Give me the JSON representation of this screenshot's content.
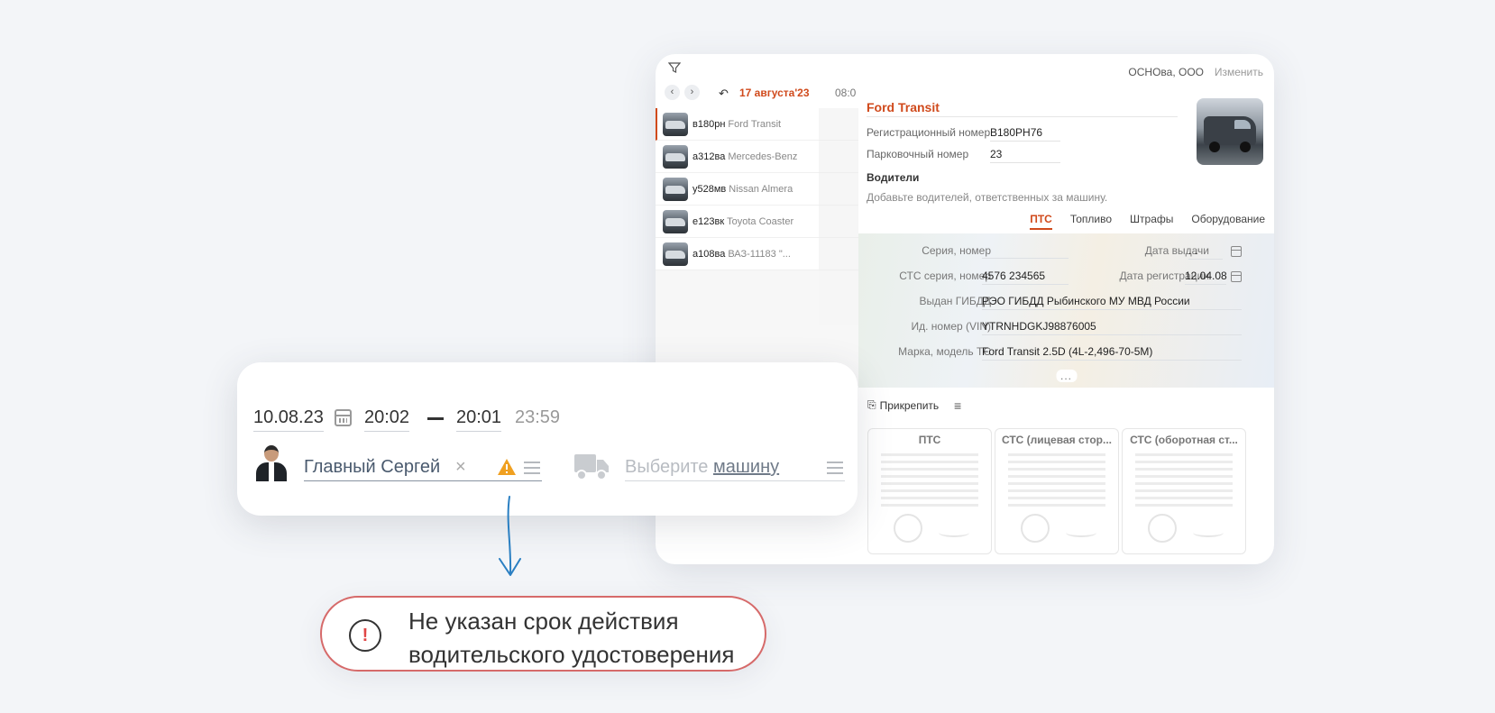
{
  "window": {
    "org_name": "ОСНОва, ООО",
    "org_change": "Изменить",
    "current_date": "17 августа'23",
    "time_header": "08:0",
    "vehicles": [
      {
        "plate": "в180рн",
        "model": "Ford Transit"
      },
      {
        "plate": "а312ва",
        "model": "Mercedes-Benz"
      },
      {
        "plate": "у528мв",
        "model": "Nissan Almera"
      },
      {
        "plate": "е123вк",
        "model": "Toyota Coaster"
      },
      {
        "plate": "а108ва",
        "model": "ВАЗ-11183 \"..."
      }
    ]
  },
  "details": {
    "title": "Ford Transit",
    "reg_label": "Регистрационный номер",
    "reg_value": "В180РН76",
    "parking_label": "Парковочный номер",
    "parking_value": "23",
    "drivers_header": "Водители",
    "drivers_hint": "Добавьте водителей, ответственных за машину.",
    "tabs": [
      "ПТС",
      "Топливо",
      "Штрафы",
      "Оборудование"
    ],
    "pts": {
      "series_label": "Серия, номер",
      "issue_date_label": "Дата выдачи",
      "issue_date_value": ". .",
      "sts_label": "СТС серия, номер",
      "sts_value": "4576 234565",
      "reg_date_label": "Дата регистрации",
      "reg_date_value": "12.04.08",
      "issued_label": "Выдан ГИБДД",
      "issued_value": "РЭО ГИБДД Рыбинского МУ МВД России",
      "vin_label": "Ид. номер (VIN)",
      "vin_value": "YTRNHDGKJ98876005",
      "model_label": "Марка, модель ТС",
      "model_value": "Ford Transit 2.5D (4L-2,496-70-5M)",
      "more": "..."
    },
    "attach_label": "Прикрепить",
    "doc_cards": [
      "ПТС",
      "СТС (лицевая стор...",
      "СТС (оборотная ст..."
    ]
  },
  "booking": {
    "date": "10.08.23",
    "time_from": "20:02",
    "time_to": "20:01",
    "duration": "23:59",
    "driver_name": "Главный Сергей",
    "clear": "×",
    "vehicle_placeholder": "Выберите",
    "vehicle_placeholder_link": "машину"
  },
  "alert": {
    "line1": "Не указан срок действия",
    "line2": "водительского удостоверения",
    "icon": "!"
  },
  "colors": {
    "accent": "#d04a1c",
    "alert_border": "#d66a6a",
    "arrow": "#2a7fc2",
    "warning": "#f0a020"
  }
}
